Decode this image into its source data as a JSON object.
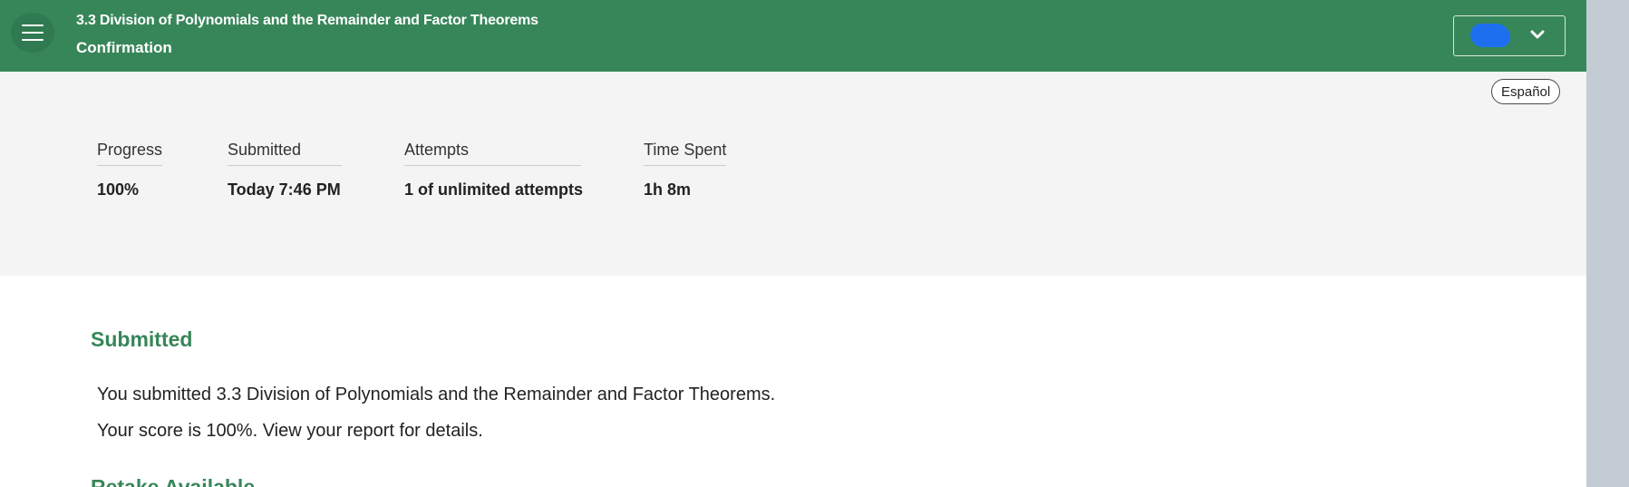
{
  "header": {
    "course_title": "3.3 Division of Polynomials and the Remainder and Factor Theorems",
    "page_title": "Confirmation",
    "menu_icon": "hamburger-menu-icon",
    "user_menu_icon": "chevron-down-icon",
    "colors": {
      "header_bg": "#378659",
      "accent": "#378659"
    }
  },
  "language": {
    "label": "Español"
  },
  "summary": {
    "progress": {
      "label": "Progress",
      "value": "100%"
    },
    "submitted": {
      "label": "Submitted",
      "value": "Today 7:46 PM"
    },
    "attempts": {
      "label": "Attempts",
      "value": "1 of unlimited attempts"
    },
    "time_spent": {
      "label": "Time Spent",
      "value": "1h 8m"
    }
  },
  "content": {
    "heading": "Submitted",
    "line1": "You submitted 3.3 Division of Polynomials and the Remainder and Factor Theorems.",
    "line2": "Your score is 100%. View your report for details.",
    "next_heading": "Retake Available"
  }
}
